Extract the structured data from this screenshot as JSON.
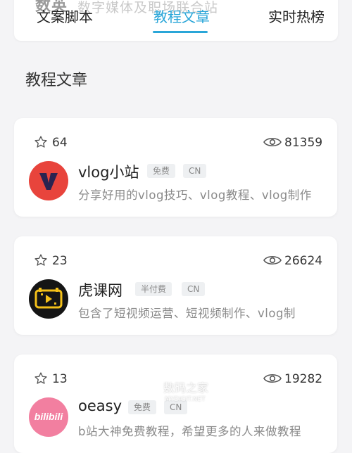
{
  "tabs": [
    {
      "label": "文案脚本",
      "active": false
    },
    {
      "label": "教程文章",
      "active": true
    },
    {
      "label": "实时热榜",
      "active": false
    }
  ],
  "accent_color": "#2aa6d8",
  "top_partial": {
    "logo_text": "数英",
    "desc": "数字媒体及职场联合站"
  },
  "section_title": "教程文章",
  "items": [
    {
      "stars": "64",
      "views": "81359",
      "name": "vlog小站",
      "tags": [
        "免费",
        "CN"
      ],
      "desc": "分享好用的vlog技巧、vlog教程、vlog制作",
      "logo_color": "#e8443c",
      "icon": "vlog-logo-icon"
    },
    {
      "stars": "23",
      "views": "26624",
      "name": "虎课网",
      "tags": [
        "半付费",
        "CN"
      ],
      "desc": "包含了短视频运营、短视频制作、vlog制",
      "logo_color": "#151515",
      "icon": "huke-logo-icon"
    },
    {
      "stars": "13",
      "views": "19282",
      "name": "oeasy",
      "tags": [
        "免费",
        "CN"
      ],
      "desc": "b站大神免费教程，希望更多的人来做教程",
      "logo_color": "#f27fa0",
      "logo_text": "bilibili",
      "icon": "bilibili-logo-icon"
    }
  ],
  "watermark": {
    "text": "数码之家",
    "sub": "MYDIGIT.NET"
  }
}
